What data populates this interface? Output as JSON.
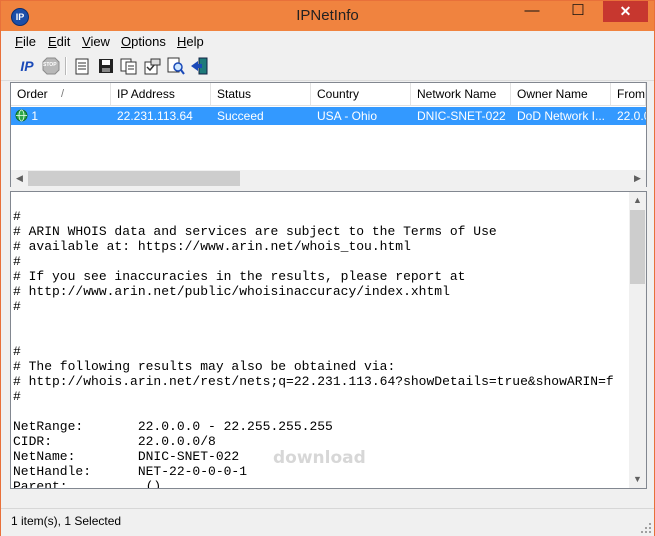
{
  "window": {
    "title": "IPNetInfo",
    "app_icon_text": "IP",
    "minimize_glyph": "—",
    "maximize_glyph": "☐",
    "close_glyph": "✕"
  },
  "menu": [
    {
      "label": "File",
      "accel": "F",
      "rest": "ile"
    },
    {
      "label": "Edit",
      "accel": "E",
      "rest": "dit"
    },
    {
      "label": "View",
      "accel": "V",
      "rest": "iew"
    },
    {
      "label": "Options",
      "accel": "O",
      "rest": "ptions"
    },
    {
      "label": "Help",
      "accel": "H",
      "rest": "elp"
    }
  ],
  "toolbar": {
    "ip_button_label": "IP",
    "stop_button_label": "STOP",
    "icons": [
      "ip-lookup-icon",
      "stop-icon",
      "properties-icon",
      "save-icon",
      "copy-icon",
      "options-icon",
      "find-icon",
      "exit-icon"
    ]
  },
  "list": {
    "columns": [
      "Order",
      "IP Address",
      "Status",
      "Country",
      "Network Name",
      "Owner Name",
      "From"
    ],
    "sort_indicator": "/",
    "rows": [
      {
        "order": "1",
        "ip": "22.231.113.64",
        "status": "Succeed",
        "country": "USA - Ohio",
        "network": "DNIC-SNET-022",
        "owner": "DoD Network I...",
        "from": "22.0.0."
      }
    ],
    "selection_color": "#3399ff"
  },
  "whois_text": "#\n# ARIN WHOIS data and services are subject to the Terms of Use\n# available at: https://www.arin.net/whois_tou.html\n#\n# If you see inaccuracies in the results, please report at\n# http://www.arin.net/public/whoisinaccuracy/index.xhtml\n#\n\n\n#\n# The following results may also be obtained via:\n# http://whois.arin.net/rest/nets;q=22.231.113.64?showDetails=true&showARIN=f\n#\n\nNetRange:       22.0.0.0 - 22.255.255.255\nCIDR:           22.0.0.0/8\nNetName:        DNIC-SNET-022\nNetHandle:      NET-22-0-0-0-1\nParent:          ()",
  "watermark": "download",
  "status": {
    "text": "1 item(s), 1 Selected"
  },
  "colors": {
    "titlebar": "#f0833f",
    "close": "#c7372f",
    "selection": "#3399ff"
  }
}
